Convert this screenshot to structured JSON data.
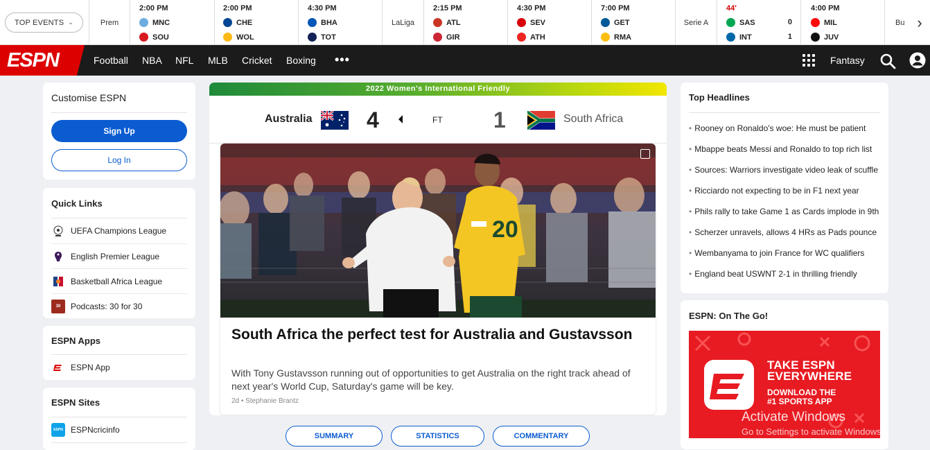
{
  "scores": {
    "top_events_label": "TOP EVENTS",
    "leagues": [
      "Prem",
      "LaLiga",
      "Serie A",
      "Bu"
    ],
    "games": [
      {
        "time": "2:00 PM",
        "home": "MNC",
        "away": "SOU",
        "home_color": "#6caddf",
        "away_color": "#d71920"
      },
      {
        "time": "2:00 PM",
        "home": "CHE",
        "away": "WOL",
        "home_color": "#034694",
        "away_color": "#fdb913"
      },
      {
        "time": "4:30 PM",
        "home": "BHA",
        "away": "TOT",
        "home_color": "#0057b8",
        "away_color": "#132257"
      },
      {
        "time": "2:15 PM",
        "home": "ATL",
        "away": "GIR",
        "home_color": "#cb3524",
        "away_color": "#cd2534"
      },
      {
        "time": "4:30 PM",
        "home": "SEV",
        "away": "ATH",
        "home_color": "#d8000a",
        "away_color": "#ee2523"
      },
      {
        "time": "7:00 PM",
        "home": "GET",
        "away": "RMA",
        "home_color": "#005999",
        "away_color": "#febe10"
      },
      {
        "time": "44'",
        "home": "SAS",
        "away": "INT",
        "home_score": "0",
        "away_score": "1",
        "live": true,
        "home_color": "#00a752",
        "away_color": "#0068a8"
      },
      {
        "time": "4:00 PM",
        "home": "MIL",
        "away": "JUV",
        "home_color": "#fb090b",
        "away_color": "#111111"
      }
    ]
  },
  "nav": {
    "logo": "ESPN",
    "items": [
      "Football",
      "NBA",
      "NFL",
      "MLB",
      "Cricket",
      "Boxing"
    ],
    "more": "•••",
    "fantasy": "Fantasy"
  },
  "customise": {
    "title": "Customise ESPN",
    "signup": "Sign Up",
    "login": "Log In"
  },
  "quick_links": {
    "title": "Quick Links",
    "items": [
      "UEFA Champions League",
      "English Premier League",
      "Basketball Africa League",
      "Podcasts: 30 for 30"
    ]
  },
  "espn_apps": {
    "title": "ESPN Apps",
    "items": [
      "ESPN App"
    ]
  },
  "espn_sites": {
    "title": "ESPN Sites",
    "items": [
      "ESPNcricinfo"
    ]
  },
  "match": {
    "banner": "2022 Women's International Friendly",
    "home_team": "Australia",
    "away_team": "South Africa",
    "home_score": "4",
    "away_score": "1",
    "status": "FT"
  },
  "story": {
    "headline": "South Africa the perfect test for Australia and Gustavsson",
    "summary": "With Tony Gustavsson running out of opportunities to get Australia on the right track ahead of next year's World Cup, Saturday's game will be key.",
    "byline": "2d • Stephanie Brantz",
    "jersey_number": "20"
  },
  "tabs": [
    "SUMMARY",
    "STATISTICS",
    "COMMENTARY"
  ],
  "headlines": {
    "title": "Top Headlines",
    "items": [
      "Rooney on Ronaldo's woe: He must be patient",
      "Mbappe beats Messi and Ronaldo to top rich list",
      "Sources: Warriors investigate video leak of scuffle",
      "Ricciardo not expecting to be in F1 next year",
      "Phils rally to take Game 1 as Cards implode in 9th",
      "Scherzer unravels, allows 4 HRs as Pads pounce",
      "Wembanyama to join France for WC qualifiers",
      "England beat USWNT 2-1 in thrilling friendly"
    ]
  },
  "on_the_go": {
    "title": "ESPN: On The Go!",
    "promo_line1": "TAKE ESPN",
    "promo_line2": "EVERYWHERE",
    "promo_line3": "DOWNLOAD THE",
    "promo_line4": "#1 SPORTS APP"
  },
  "watermark": {
    "line1": "Activate Windows",
    "line2": "Go to Settings to activate Windows."
  },
  "colors": {
    "espn_red": "#d00000",
    "nav_bg": "#1b1b1b",
    "primary_blue": "#0b5cd1",
    "live_red": "#cc0000"
  }
}
